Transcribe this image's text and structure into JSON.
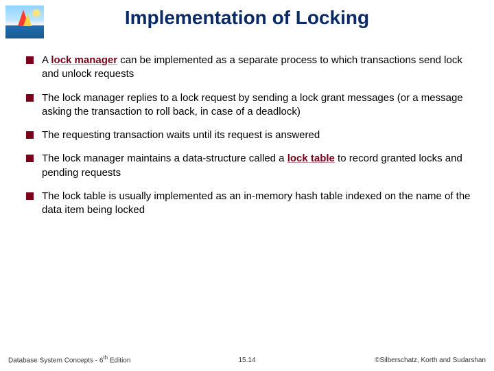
{
  "title": "Implementation of Locking",
  "bullets": [
    {
      "prefix": "A ",
      "term": "lock manager",
      "rest": " can be implemented as a separate process to which transactions send lock and unlock requests"
    },
    {
      "prefix": "",
      "term": "",
      "rest": "The lock manager replies to a lock request by sending a lock grant messages (or a message asking the transaction to roll back, in case of a deadlock)"
    },
    {
      "prefix": "",
      "term": "",
      "rest": "The requesting transaction waits until its request is answered"
    },
    {
      "prefix": "The lock manager maintains a data-structure called a ",
      "term": "lock table",
      "rest": " to record granted locks and pending requests"
    },
    {
      "prefix": "",
      "term": "",
      "rest": "The lock table is usually implemented as an in-memory hash table indexed on the name of the data item being locked"
    }
  ],
  "footer": {
    "left_a": "Database System Concepts - 6",
    "left_sup": "th",
    "left_b": " Edition",
    "center": "15.14",
    "right": "©Silberschatz, Korth and Sudarshan"
  }
}
